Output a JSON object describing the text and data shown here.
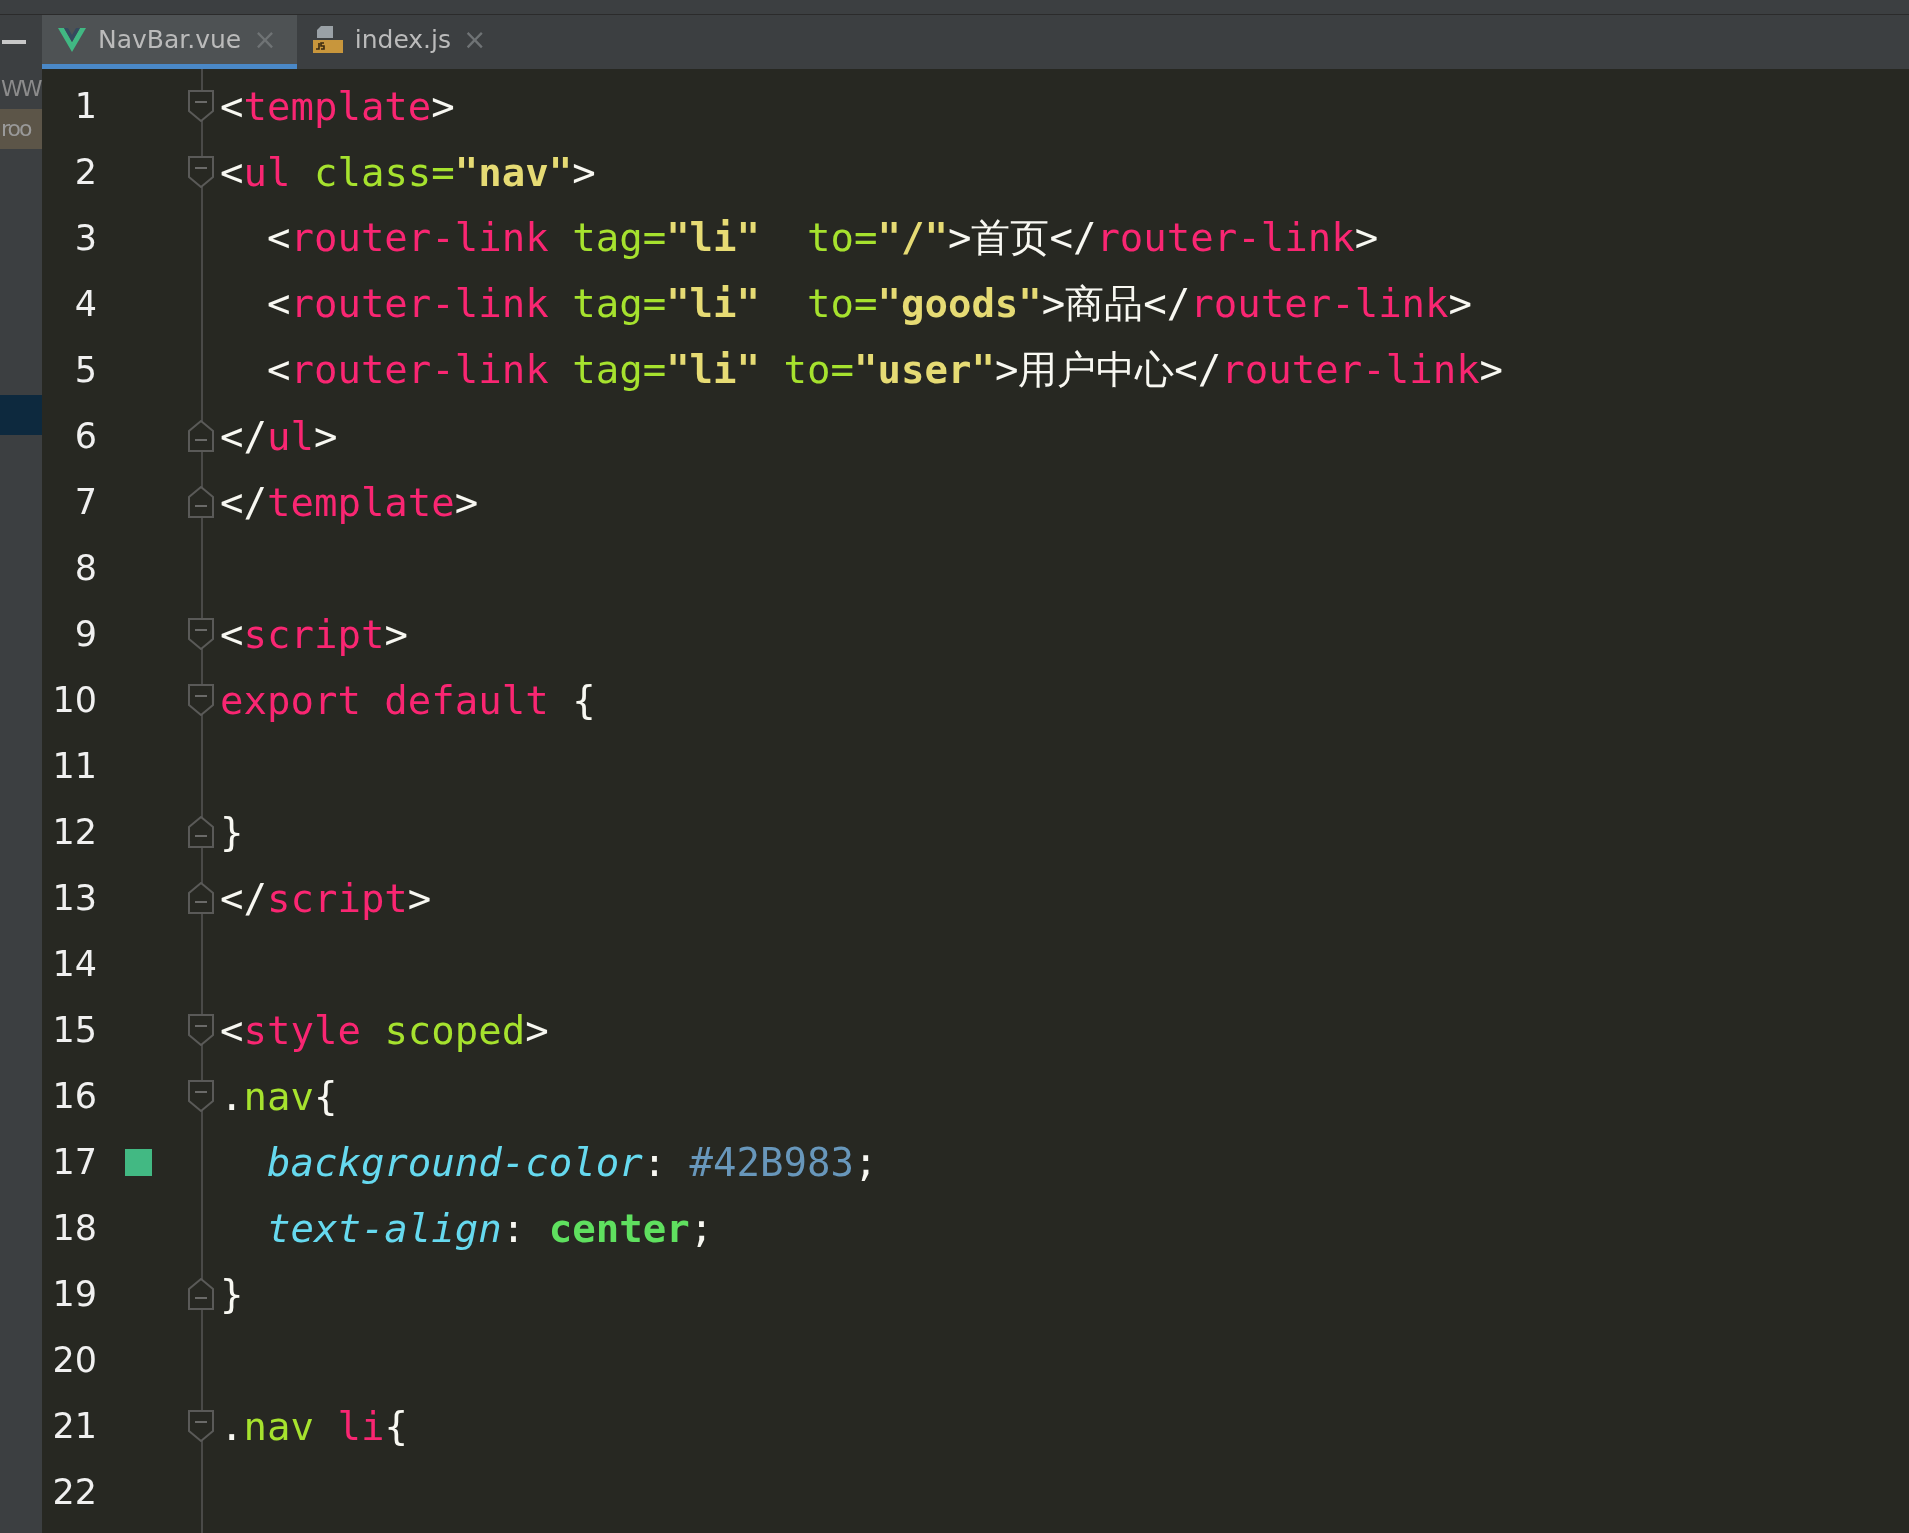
{
  "sidebar": {
    "items": [
      {
        "label": "WW",
        "selected": false,
        "highlighted": false
      },
      {
        "label": "roo",
        "selected": false,
        "highlighted": true
      },
      {
        "selected": true,
        "highlighted": false
      }
    ]
  },
  "tabs": [
    {
      "label": "NavBar.vue",
      "kind": "vue",
      "selected": true,
      "close": "×"
    },
    {
      "label": "index.js",
      "kind": "js",
      "selected": false,
      "close": "×"
    }
  ],
  "editor": {
    "lines": [
      {
        "number": "1",
        "fold_start": true,
        "fold_end": false,
        "tokens": [
          {
            "kind": "punct",
            "text": "<"
          },
          {
            "kind": "tag",
            "text": "template"
          },
          {
            "kind": "punct",
            "text": ">"
          }
        ]
      },
      {
        "number": "2",
        "fold_start": true,
        "fold_end": false,
        "tokens": [
          {
            "kind": "punct",
            "text": "<"
          },
          {
            "kind": "tag",
            "text": "ul "
          },
          {
            "kind": "attr",
            "text": "class="
          },
          {
            "kind": "string",
            "text": "\"nav\""
          },
          {
            "kind": "punct",
            "text": ">"
          }
        ]
      },
      {
        "number": "3",
        "fold_start": false,
        "fold_end": false,
        "tokens": [
          {
            "kind": "punct",
            "text": "  <"
          },
          {
            "kind": "tag",
            "text": "router-link "
          },
          {
            "kind": "attr",
            "text": "tag="
          },
          {
            "kind": "string",
            "text": "\"li\""
          },
          {
            "kind": "attr",
            "text": "  to="
          },
          {
            "kind": "string",
            "text": "\"/\""
          },
          {
            "kind": "punct",
            "text": ">首页</"
          },
          {
            "kind": "tag",
            "text": "router-link"
          },
          {
            "kind": "punct",
            "text": ">"
          }
        ]
      },
      {
        "number": "4",
        "fold_start": false,
        "fold_end": false,
        "tokens": [
          {
            "kind": "punct",
            "text": "  <"
          },
          {
            "kind": "tag",
            "text": "router-link "
          },
          {
            "kind": "attr",
            "text": "tag="
          },
          {
            "kind": "string",
            "text": "\"li\""
          },
          {
            "kind": "attr",
            "text": "  to="
          },
          {
            "kind": "string",
            "text": "\"goods\""
          },
          {
            "kind": "punct",
            "text": ">商品</"
          },
          {
            "kind": "tag",
            "text": "router-link"
          },
          {
            "kind": "punct",
            "text": ">"
          }
        ]
      },
      {
        "number": "5",
        "fold_start": false,
        "fold_end": false,
        "tokens": [
          {
            "kind": "punct",
            "text": "  <"
          },
          {
            "kind": "tag",
            "text": "router-link "
          },
          {
            "kind": "attr",
            "text": "tag="
          },
          {
            "kind": "string",
            "text": "\"li\""
          },
          {
            "kind": "attr",
            "text": " to="
          },
          {
            "kind": "string",
            "text": "\"user\""
          },
          {
            "kind": "punct",
            "text": ">用户中心</"
          },
          {
            "kind": "tag",
            "text": "router-link"
          },
          {
            "kind": "punct",
            "text": ">"
          }
        ]
      },
      {
        "number": "6",
        "fold_start": false,
        "fold_end": true,
        "tokens": [
          {
            "kind": "punct",
            "text": "</"
          },
          {
            "kind": "tag",
            "text": "ul"
          },
          {
            "kind": "punct",
            "text": ">"
          }
        ]
      },
      {
        "number": "7",
        "fold_start": false,
        "fold_end": true,
        "tokens": [
          {
            "kind": "punct",
            "text": "</"
          },
          {
            "kind": "tag",
            "text": "template"
          },
          {
            "kind": "punct",
            "text": ">"
          }
        ]
      },
      {
        "number": "8",
        "fold_start": false,
        "fold_end": false
      },
      {
        "number": "9",
        "fold_start": true,
        "fold_end": false,
        "tokens": [
          {
            "kind": "punct",
            "text": "<"
          },
          {
            "kind": "tag",
            "text": "script"
          },
          {
            "kind": "punct",
            "text": ">"
          }
        ]
      },
      {
        "number": "10",
        "fold_start": true,
        "fold_end": false,
        "tokens": [
          {
            "kind": "tag",
            "text": "export default "
          },
          {
            "kind": "punct",
            "text": "{"
          }
        ]
      },
      {
        "number": "11",
        "fold_start": false,
        "fold_end": false
      },
      {
        "number": "12",
        "fold_start": false,
        "fold_end": true,
        "tokens": [
          {
            "kind": "punct",
            "text": "}"
          }
        ]
      },
      {
        "number": "13",
        "fold_start": false,
        "fold_end": true,
        "tokens": [
          {
            "kind": "punct",
            "text": "</"
          },
          {
            "kind": "tag",
            "text": "script"
          },
          {
            "kind": "punct",
            "text": ">"
          }
        ]
      },
      {
        "number": "14",
        "fold_start": false,
        "fold_end": false
      },
      {
        "number": "15",
        "fold_start": true,
        "fold_end": false,
        "tokens": [
          {
            "kind": "punct",
            "text": "<"
          },
          {
            "kind": "tag",
            "text": "style "
          },
          {
            "kind": "attr",
            "text": "scoped"
          },
          {
            "kind": "punct",
            "text": ">"
          }
        ]
      },
      {
        "number": "16",
        "fold_start": true,
        "fold_end": false,
        "tokens": [
          {
            "kind": "punct",
            "text": "."
          },
          {
            "kind": "attr",
            "text": "nav"
          },
          {
            "kind": "punct",
            "text": "{"
          }
        ]
      },
      {
        "number": "17",
        "fold_start": false,
        "fold_end": false,
        "color": "#42b983",
        "tokens": [
          {
            "kind": "property",
            "text": "  background-color"
          },
          {
            "kind": "punct",
            "text": ": "
          },
          {
            "kind": "number",
            "text": "#42B983"
          },
          {
            "kind": "punct",
            "text": ";"
          }
        ]
      },
      {
        "number": "18",
        "fold_start": false,
        "fold_end": false,
        "tokens": [
          {
            "kind": "property",
            "text": "  text-align"
          },
          {
            "kind": "punct",
            "text": ": "
          },
          {
            "kind": "value",
            "text": "center"
          },
          {
            "kind": "punct",
            "text": ";"
          }
        ]
      },
      {
        "number": "19",
        "fold_start": false,
        "fold_end": true,
        "tokens": [
          {
            "kind": "punct",
            "text": "}"
          }
        ]
      },
      {
        "number": "20",
        "fold_start": false,
        "fold_end": false
      },
      {
        "number": "21",
        "fold_start": true,
        "fold_end": false,
        "tokens": [
          {
            "kind": "punct",
            "text": "."
          },
          {
            "kind": "attr",
            "text": "nav "
          },
          {
            "kind": "tag",
            "text": "li"
          },
          {
            "kind": "punct",
            "text": "{"
          }
        ]
      },
      {
        "number": "22",
        "fold_start": false,
        "fold_end": false
      }
    ]
  }
}
